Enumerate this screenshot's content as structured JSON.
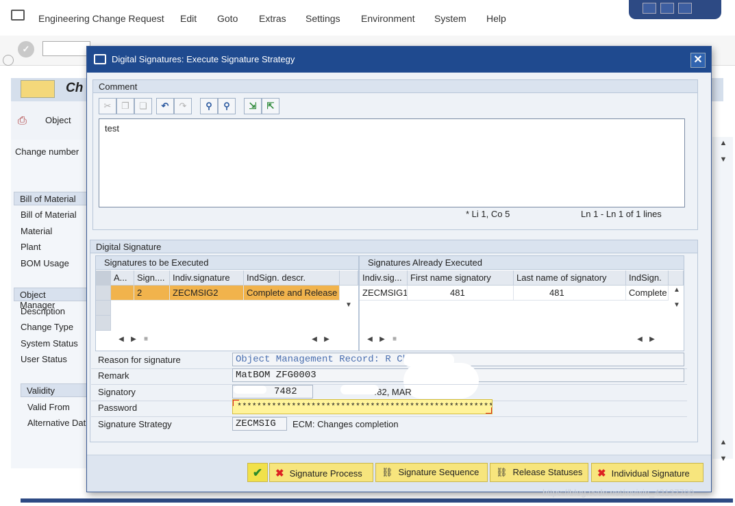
{
  "menubar": {
    "items": [
      "Engineering Change Request",
      "Edit",
      "Goto",
      "Extras",
      "Settings",
      "Environment",
      "System",
      "Help"
    ]
  },
  "background": {
    "title_partial": "Ch",
    "apptool_object": "Object",
    "change_number_label": "Change number",
    "bom_group_header": "Bill of Material",
    "bom_fields": [
      "Bill of Material",
      "Material",
      "Plant",
      "BOM Usage"
    ],
    "object_group_header": "Object Manager",
    "object_fields": [
      "Description",
      "Change Type",
      "System Status",
      "User Status"
    ],
    "validity_group_header": "Validity",
    "validity_fields": [
      "Valid From",
      "Alternative Dat"
    ]
  },
  "dialog": {
    "title": "Digital Signatures: Execute Signature Strategy",
    "close_glyph": "✕",
    "comment": {
      "header": "Comment",
      "text": "test",
      "cursor_status": "* Li 1, Co 5",
      "line_status": "Ln 1 - Ln 1 of 1 lines"
    },
    "digital_signature": {
      "header": "Digital Signature",
      "to_execute": {
        "title": "Signatures to be Executed",
        "columns": [
          "A...",
          "Sign....",
          "Indiv.signature",
          "IndSign. descr."
        ],
        "rows": [
          [
            "",
            "2",
            "ZECMSIG2",
            "Complete and Release"
          ]
        ]
      },
      "executed": {
        "title": "Signatures Already Executed",
        "columns": [
          "Indiv.sig...",
          "First name signatory",
          "Last name of signatory",
          "IndSign."
        ],
        "rows": [
          [
            "ZECMSIG1",
            "481",
            "481",
            "Complete"
          ]
        ]
      },
      "nav_glyphs": [
        "◀",
        "▶",
        "≡",
        "▲",
        "▼"
      ]
    },
    "fields": {
      "reason_label": "Reason for signature",
      "reason_value": "Object Management Record: R         Change",
      "remark_label": "Remark",
      "remark_value": "MatBOM      ZFG0003",
      "signatory_label": "Signatory",
      "signatory_id_partial": "7482",
      "signatory_name_partial": "482, MAR",
      "password_label": "Password",
      "password_value": "********************************************************",
      "strategy_label": "Signature Strategy",
      "strategy_value": "ZECMSIG",
      "strategy_desc": "ECM: Changes completion"
    },
    "footer": {
      "ok_glyph": "✔",
      "signature_process": "Signature Process",
      "signature_sequence": "Signature Sequence",
      "release_statuses": "Release Statuses",
      "individual_signature": "Individual Signature"
    }
  },
  "watermark": "https://blog.csdn.net/weixin_42137700"
}
